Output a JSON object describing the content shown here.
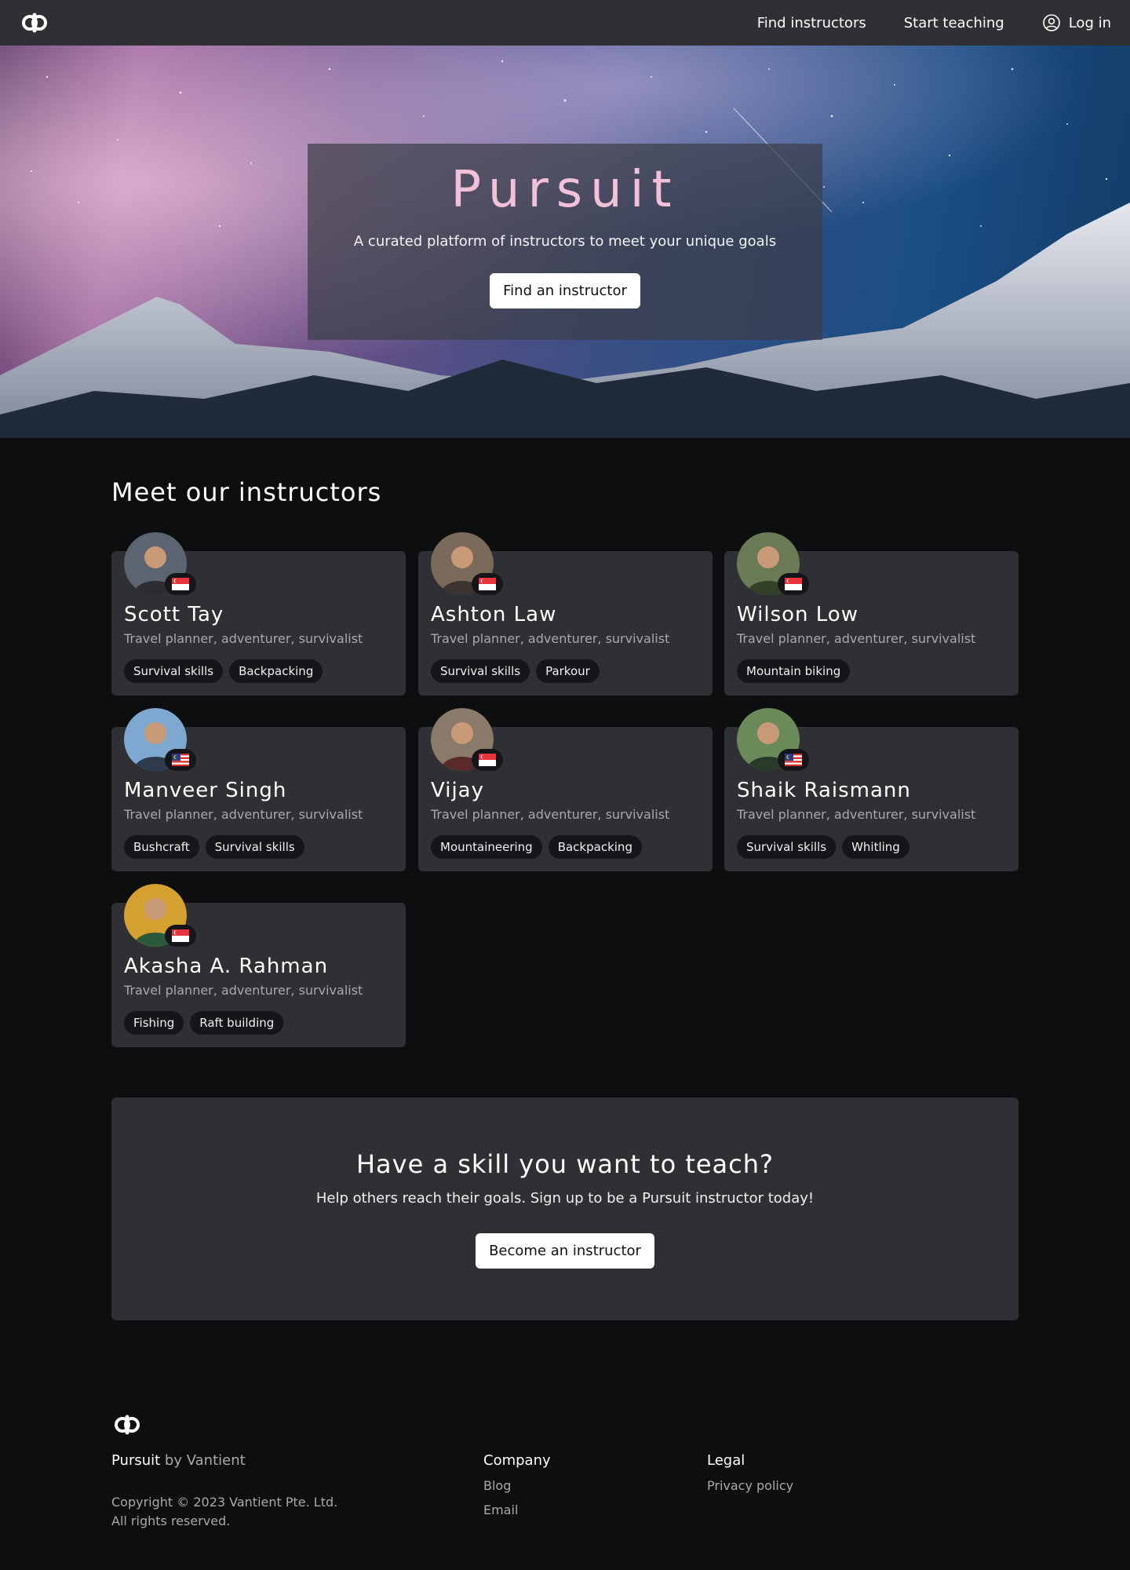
{
  "nav": {
    "logo_icon": "pursuit-logo-icon",
    "find_instructors": "Find instructors",
    "start_teaching": "Start teaching",
    "login": "Log in",
    "login_icon": "user-circle-icon"
  },
  "hero": {
    "title": "Pursuit",
    "subtitle": "A curated platform of instructors to meet your unique goals",
    "cta": "Find an instructor"
  },
  "instructors": {
    "heading": "Meet our instructors",
    "cards": [
      {
        "name": "Scott Tay",
        "desc": "Travel planner, adventurer, survivalist",
        "flag": "singapore-flag-icon",
        "tags": [
          "Survival skills",
          "Backpacking"
        ]
      },
      {
        "name": "Ashton Law",
        "desc": "Travel planner, adventurer, survivalist",
        "flag": "singapore-flag-icon",
        "tags": [
          "Survival skills",
          "Parkour"
        ]
      },
      {
        "name": "Wilson Low",
        "desc": "Travel planner, adventurer, survivalist",
        "flag": "singapore-flag-icon",
        "tags": [
          "Mountain biking"
        ]
      },
      {
        "name": "Manveer Singh",
        "desc": "Travel planner, adventurer, survivalist",
        "flag": "malaysia-flag-icon",
        "tags": [
          "Bushcraft",
          "Survival skills"
        ]
      },
      {
        "name": "Vijay",
        "desc": "Travel planner, adventurer, survivalist",
        "flag": "singapore-flag-icon",
        "tags": [
          "Mountaineering",
          "Backpacking"
        ]
      },
      {
        "name": "Shaik Raismann",
        "desc": "Travel planner, adventurer, survivalist",
        "flag": "malaysia-flag-icon",
        "tags": [
          "Survival skills",
          "Whitling"
        ]
      },
      {
        "name": "Akasha A. Rahman",
        "desc": "Travel planner, adventurer, survivalist",
        "flag": "singapore-flag-icon",
        "tags": [
          "Fishing",
          "Raft building"
        ]
      }
    ]
  },
  "cta": {
    "title": "Have a skill you want to teach?",
    "subtitle": "Help others reach their goals. Sign up to be a Pursuit instructor today!",
    "button": "Become an instructor"
  },
  "footer": {
    "brand": "Pursuit",
    "by": " by Vantient",
    "copyright_line1": "Copyright © 2023 Vantient Pte. Ltd.",
    "copyright_line2": "All rights reserved.",
    "company_heading": "Company",
    "company_links": [
      "Blog",
      "Email"
    ],
    "legal_heading": "Legal",
    "legal_links": [
      "Privacy policy"
    ]
  },
  "colors": {
    "accent_title": "#f2c0d8",
    "nav_bg": "#2e3034",
    "page_bg": "#0d0e10",
    "card_bg": "#2e3034",
    "tag_bg": "#15161a"
  }
}
